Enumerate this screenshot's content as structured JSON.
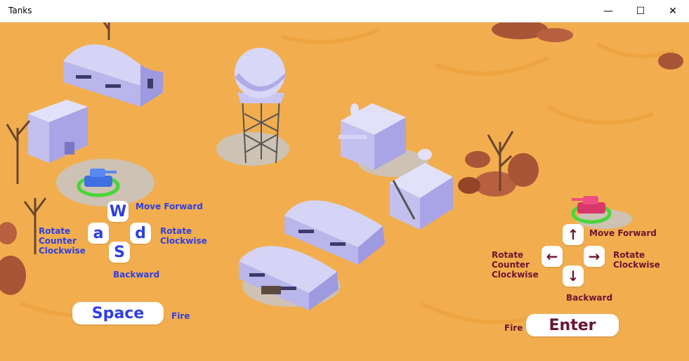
{
  "window": {
    "title": "Tanks",
    "minimize_glyph": "—",
    "maximize_glyph": "☐",
    "close_glyph": "✕"
  },
  "player1": {
    "color": "#2f3fe0",
    "keys": {
      "up": "W",
      "left": "a",
      "right": "d",
      "down": "S",
      "fire": "Space"
    },
    "labels": {
      "forward": "Move Forward",
      "rotate_ccw": [
        "Rotate",
        "Counter",
        "Clockwise"
      ],
      "rotate_cw": [
        "Rotate",
        "Clockwise"
      ],
      "backward": "Backward",
      "fire": "Fire"
    }
  },
  "player2": {
    "color": "#6a1431",
    "keys": {
      "up": "↑",
      "left": "←",
      "right": "→",
      "down": "↓",
      "fire": "Enter"
    },
    "labels": {
      "forward": "Move Forward",
      "rotate_ccw": [
        "Rotate",
        "Counter",
        "Clockwise"
      ],
      "rotate_cw": [
        "Rotate",
        "Clockwise"
      ],
      "backward": "Backward",
      "fire": "Fire"
    }
  },
  "colors": {
    "ground": "#f2ae4e",
    "building": "#c8c6f2",
    "rubble": "#c9c4bf",
    "rock": "#b8603f"
  }
}
